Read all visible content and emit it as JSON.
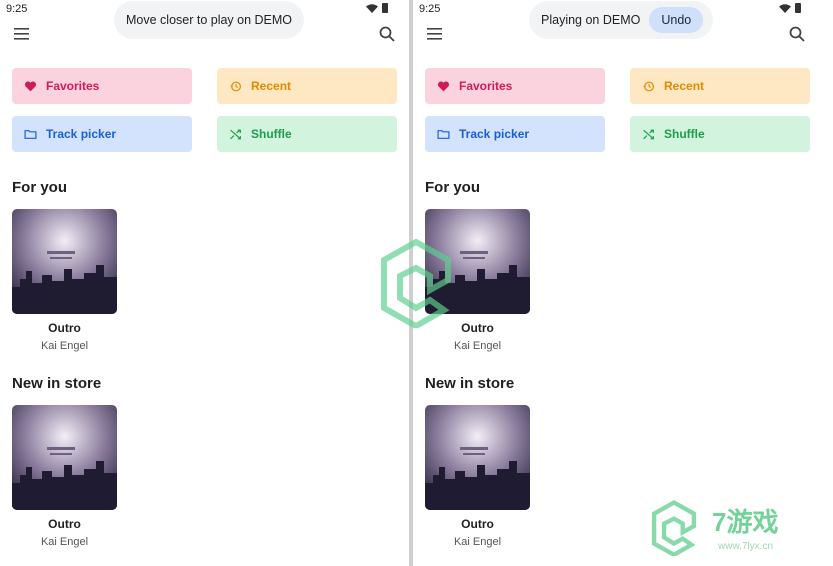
{
  "left": {
    "status_time": "9:25",
    "toast_text": "Move closer to play on DEMO",
    "chips": {
      "favorites": "Favorites",
      "recent": "Recent",
      "track_picker": "Track picker",
      "shuffle": "Shuffle"
    },
    "for_you_title": "For you",
    "for_you_album": {
      "title": "Outro",
      "artist": "Kai Engel"
    },
    "new_in_store_title": "New in store",
    "new_album": {
      "title": "Outro",
      "artist": "Kai Engel"
    }
  },
  "right": {
    "status_time": "9:25",
    "toast_text": "Playing on DEMO",
    "undo_label": "Undo",
    "chips": {
      "favorites": "Favorites",
      "recent": "Recent",
      "track_picker": "Track picker",
      "shuffle": "Shuffle"
    },
    "for_you_title": "For you",
    "for_you_album": {
      "title": "Outro",
      "artist": "Kai Engel"
    },
    "new_in_store_title": "New in store",
    "new_album": {
      "title": "Outro",
      "artist": "Kai Engel"
    }
  },
  "watermark": {
    "text": "7游戏",
    "url": "www.7lyx.cn"
  },
  "colors": {
    "favorites_bg": "#fbd3df",
    "favorites_fg": "#d11b54",
    "recent_bg": "#fde8c3",
    "recent_fg": "#e08a00",
    "track_bg": "#d3e3fd",
    "track_fg": "#1a5fd3",
    "shuffle_bg": "#d2f3de",
    "shuffle_fg": "#1e9d4b",
    "undo_bg": "#cfe0fb"
  },
  "icons": [
    "menu-icon",
    "search-icon",
    "heart-icon",
    "history-icon",
    "folder-icon",
    "shuffle-icon",
    "wifi-icon",
    "battery-icon"
  ]
}
